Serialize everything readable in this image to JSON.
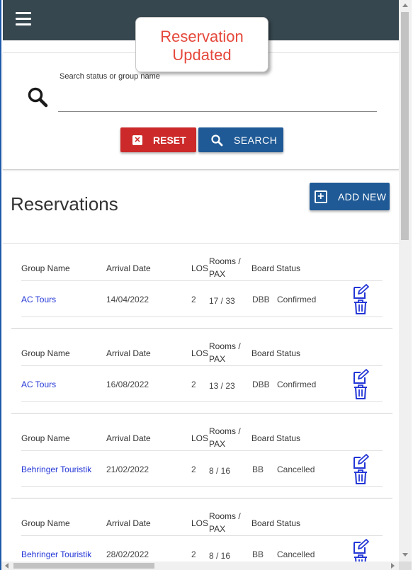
{
  "toast": {
    "message": "Reservation Updated"
  },
  "search": {
    "label": "Search status or group name",
    "value": "",
    "reset_label": "RESET",
    "search_label": "SEARCH"
  },
  "section": {
    "title": "Reservations",
    "add_label": "ADD NEW"
  },
  "columns": {
    "group_name": "Group Name",
    "arrival_date": "Arrival Date",
    "los": "LOS",
    "rooms_pax": "Rooms / PAX",
    "board": "Board",
    "status": "Status"
  },
  "reservations": [
    {
      "group_name": "AC Tours",
      "arrival_date": "14/04/2022",
      "los": "2",
      "rooms_pax": "17 / 33",
      "board": "DBB",
      "status": "Confirmed"
    },
    {
      "group_name": "AC Tours",
      "arrival_date": "16/08/2022",
      "los": "2",
      "rooms_pax": "13 / 23",
      "board": "DBB",
      "status": "Confirmed"
    },
    {
      "group_name": "Behringer Touristik",
      "arrival_date": "21/02/2022",
      "los": "2",
      "rooms_pax": "8 / 16",
      "board": "BB",
      "status": "Cancelled"
    },
    {
      "group_name": "Behringer Touristik",
      "arrival_date": "28/02/2022",
      "los": "2",
      "rooms_pax": "8 / 16",
      "board": "BB",
      "status": "Cancelled"
    }
  ],
  "colors": {
    "appbar": "#37474f",
    "reset": "#cc2a2a",
    "primary": "#1f5a96",
    "link": "#2336d6",
    "toast_text": "#e5483b"
  },
  "icons": {
    "menu": "hamburger-icon",
    "search": "search-icon",
    "reset": "close-icon",
    "add": "plus-icon",
    "edit": "edit-icon",
    "delete": "trash-icon"
  }
}
